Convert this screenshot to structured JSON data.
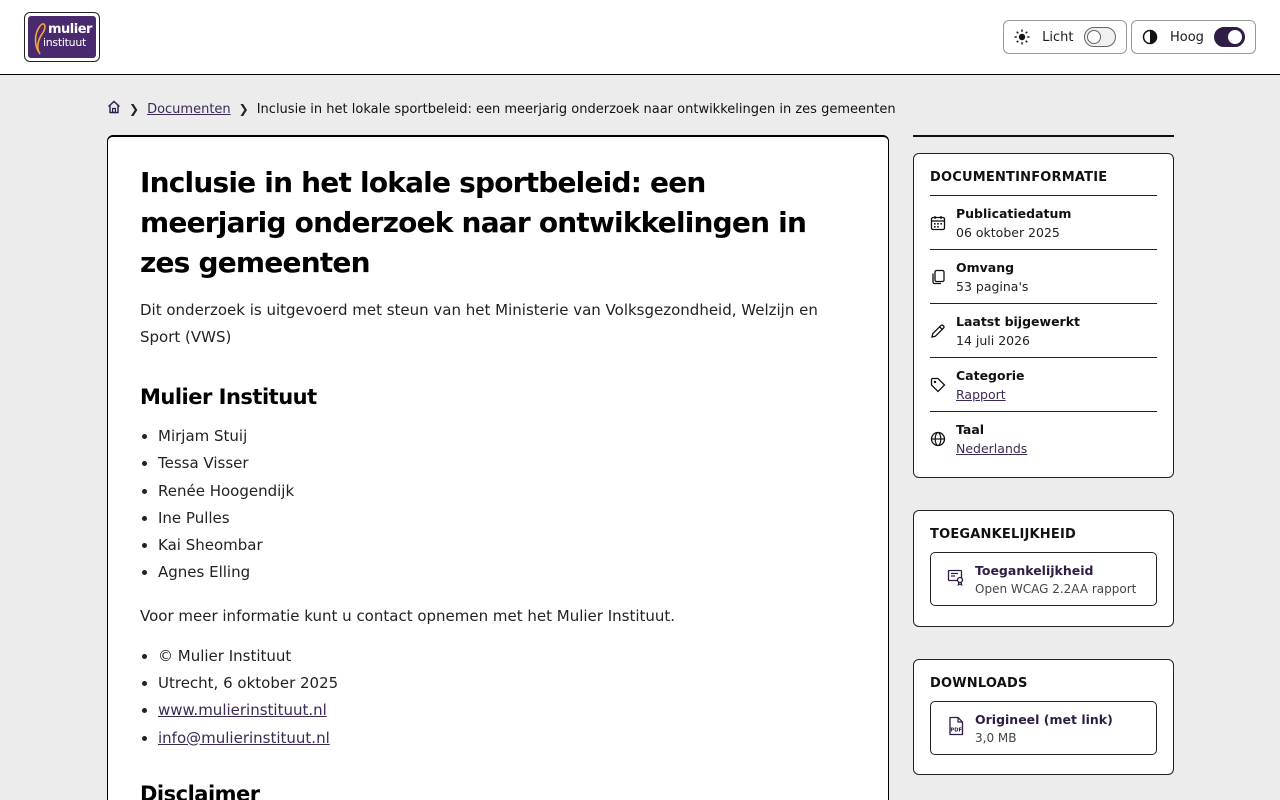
{
  "header": {
    "logo": {
      "line1": "mulier",
      "line2": "instituut"
    },
    "toggles": [
      {
        "label": "Licht",
        "icon": "sun-icon",
        "state": "off"
      },
      {
        "label": "Hoog",
        "icon": "contrast-icon",
        "state": "on"
      }
    ]
  },
  "breadcrumb": {
    "home_icon": "home-icon",
    "items": [
      "Documenten",
      "Inclusie in het lokale sportbeleid: een meerjarig onderzoek naar ontwikkelingen in zes gemeenten"
    ]
  },
  "main": {
    "title": "Inclusie in het lokale sportbeleid: een meerjarig onderzoek naar ontwikkelingen in zes gemeenten",
    "subtitle": "Dit onderzoek is uitgevoerd met steun van het Ministerie van Volksgezondheid, Welzijn en Sport (VWS)",
    "section_heading": "Mulier Instituut",
    "authors": [
      "Mirjam Stuij",
      "Tessa Visser",
      "Renée Hoogendijk",
      "Ine Pulles",
      "Kai Sheombar",
      "Agnes Elling"
    ],
    "contact_text": "Voor meer informatie kunt u contact opnemen met het Mulier Instituut.",
    "meta": {
      "copyright": "© Mulier Instituut",
      "place_date": "Utrecht, 6 oktober 2025",
      "website": "www.mulierinstituut.nl",
      "email": "info@mulierinstituut.nl"
    },
    "disclaimer_heading": "Disclaimer"
  },
  "sidebar": {
    "docinfo": {
      "heading": "DOCUMENTINFORMATIE",
      "rows": [
        {
          "icon": "calendar-icon",
          "label": "Publicatiedatum",
          "value": "06 oktober 2025"
        },
        {
          "icon": "pages-icon",
          "label": "Omvang",
          "value": "53 pagina's"
        },
        {
          "icon": "pencil-icon",
          "label": "Laatst bijgewerkt",
          "value": "14 juli 2026"
        },
        {
          "icon": "tag-icon",
          "label": "Categorie",
          "value": "Rapport"
        },
        {
          "icon": "globe-icon",
          "label": "Taal",
          "value": "Nederlands"
        }
      ]
    },
    "accessibility": {
      "heading": "TOEGANKELIJKHEID",
      "item": {
        "icon": "certificate-icon",
        "title": "Toegankelijkheid",
        "subtitle": "Open WCAG 2.2AA rapport"
      }
    },
    "downloads": {
      "heading": "DOWNLOADS",
      "item": {
        "icon": "pdf-icon",
        "title": "Origineel (met link)",
        "subtitle": "3,0 MB"
      }
    }
  }
}
